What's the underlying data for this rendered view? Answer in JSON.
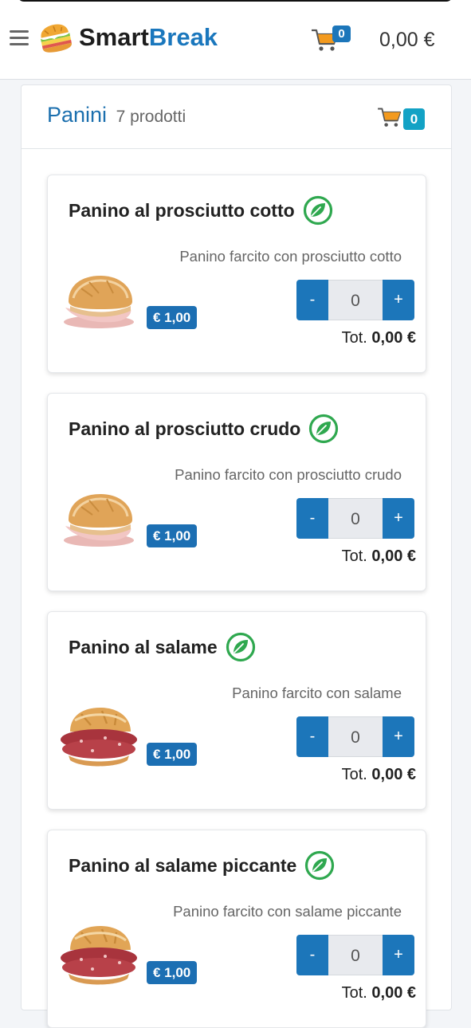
{
  "header": {
    "brand_part1": "Smart",
    "brand_part2": "Break",
    "cart_count": "0",
    "cart_total": "0,00 €"
  },
  "category": {
    "title": "Panini",
    "count_label": "7 prodotti",
    "cart_count": "0"
  },
  "products": [
    {
      "name": "Panino al prosciutto cotto",
      "description": "Panino farcito con prosciutto cotto",
      "price": "€ 1,00",
      "qty": "0",
      "minus_label": "-",
      "plus_label": "+",
      "tot_label": "Tot.",
      "tot_value": "0,00 €",
      "icon": "leaf-icon",
      "image": "ham-sandwich"
    },
    {
      "name": "Panino al prosciutto crudo",
      "description": "Panino farcito con prosciutto crudo",
      "price": "€ 1,00",
      "qty": "0",
      "minus_label": "-",
      "plus_label": "+",
      "tot_label": "Tot.",
      "tot_value": "0,00 €",
      "icon": "leaf-icon",
      "image": "cured-ham-sandwich"
    },
    {
      "name": "Panino al salame",
      "description": "Panino farcito con salame",
      "price": "€ 1,00",
      "qty": "0",
      "minus_label": "-",
      "plus_label": "+",
      "tot_label": "Tot.",
      "tot_value": "0,00 €",
      "icon": "leaf-icon",
      "image": "salami-sandwich"
    },
    {
      "name": "Panino al salame piccante",
      "description": "Panino farcito con salame piccante",
      "price": "€ 1,00",
      "qty": "0",
      "minus_label": "-",
      "plus_label": "+",
      "tot_label": "Tot.",
      "tot_value": "0,00 €",
      "icon": "leaf-icon",
      "image": "spicy-salami-sandwich"
    }
  ],
  "colors": {
    "brand_blue": "#1a77bd",
    "button_blue": "#1c76ba",
    "badge_teal": "#13a2c5",
    "leaf_green": "#2fa84f"
  }
}
